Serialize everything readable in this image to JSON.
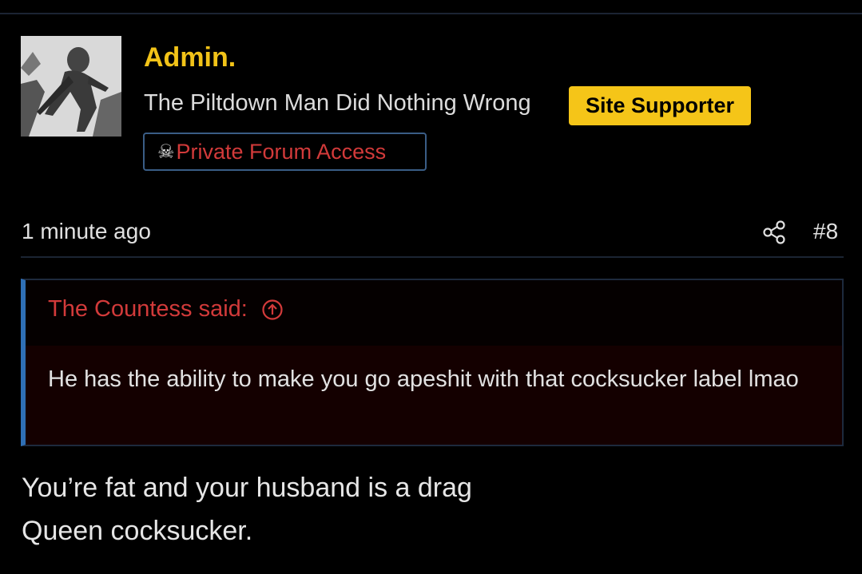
{
  "post": {
    "author": "Admin.",
    "user_title": "The Piltdown Man Did Nothing Wrong",
    "badge_supporter": "Site Supporter",
    "badge_private": "Private Forum Access",
    "badge_private_icon": "skull-crossbones-icon",
    "timestamp": "1 minute ago",
    "post_number": "#8",
    "quote": {
      "author_line": "The Countess said:",
      "text": "He has the ability to make you go apeshit with that cocksucker label lmao"
    },
    "message_line1": "You’re fat and your husband is a drag",
    "message_line2": "Queen cocksucker."
  },
  "colors": {
    "username": "#f2c318",
    "badge_supporter_bg": "#f5c518",
    "badge_private_text": "#d23a3a",
    "quote_accent": "#2f6fb5",
    "background": "#000000"
  }
}
